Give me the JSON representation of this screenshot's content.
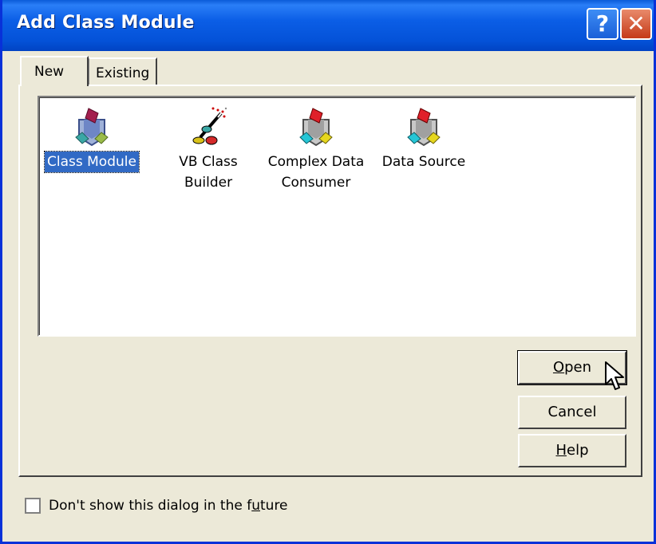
{
  "window": {
    "title": "Add Class Module"
  },
  "titlebar": {
    "help_glyph": "?",
    "close_glyph": "✕"
  },
  "tabs": [
    {
      "label": "New",
      "active": true
    },
    {
      "label": "Existing",
      "active": false
    }
  ],
  "items": [
    {
      "line1": "Class Module",
      "line2": "",
      "selected": true,
      "icon": "class-module-icon"
    },
    {
      "line1": "VB Class",
      "line2": "Builder",
      "selected": false,
      "icon": "wand-icon"
    },
    {
      "line1": "Complex Data",
      "line2": "Consumer",
      "selected": false,
      "icon": "complex-data-consumer-icon"
    },
    {
      "line1": "Data Source",
      "line2": "",
      "selected": false,
      "icon": "data-source-icon"
    }
  ],
  "buttons": {
    "open": {
      "mnemonic": "O",
      "rest": "pen"
    },
    "cancel": {
      "label": "Cancel"
    },
    "help": {
      "mnemonic": "H",
      "rest": "elp"
    }
  },
  "checkbox": {
    "pre": "Don't show this dialog in the f",
    "mnemonic": "u",
    "post": "ture",
    "checked": false
  },
  "colors": {
    "titlebar": "#0b5ee6",
    "face": "#ece9d8",
    "selection": "#316ac5"
  }
}
